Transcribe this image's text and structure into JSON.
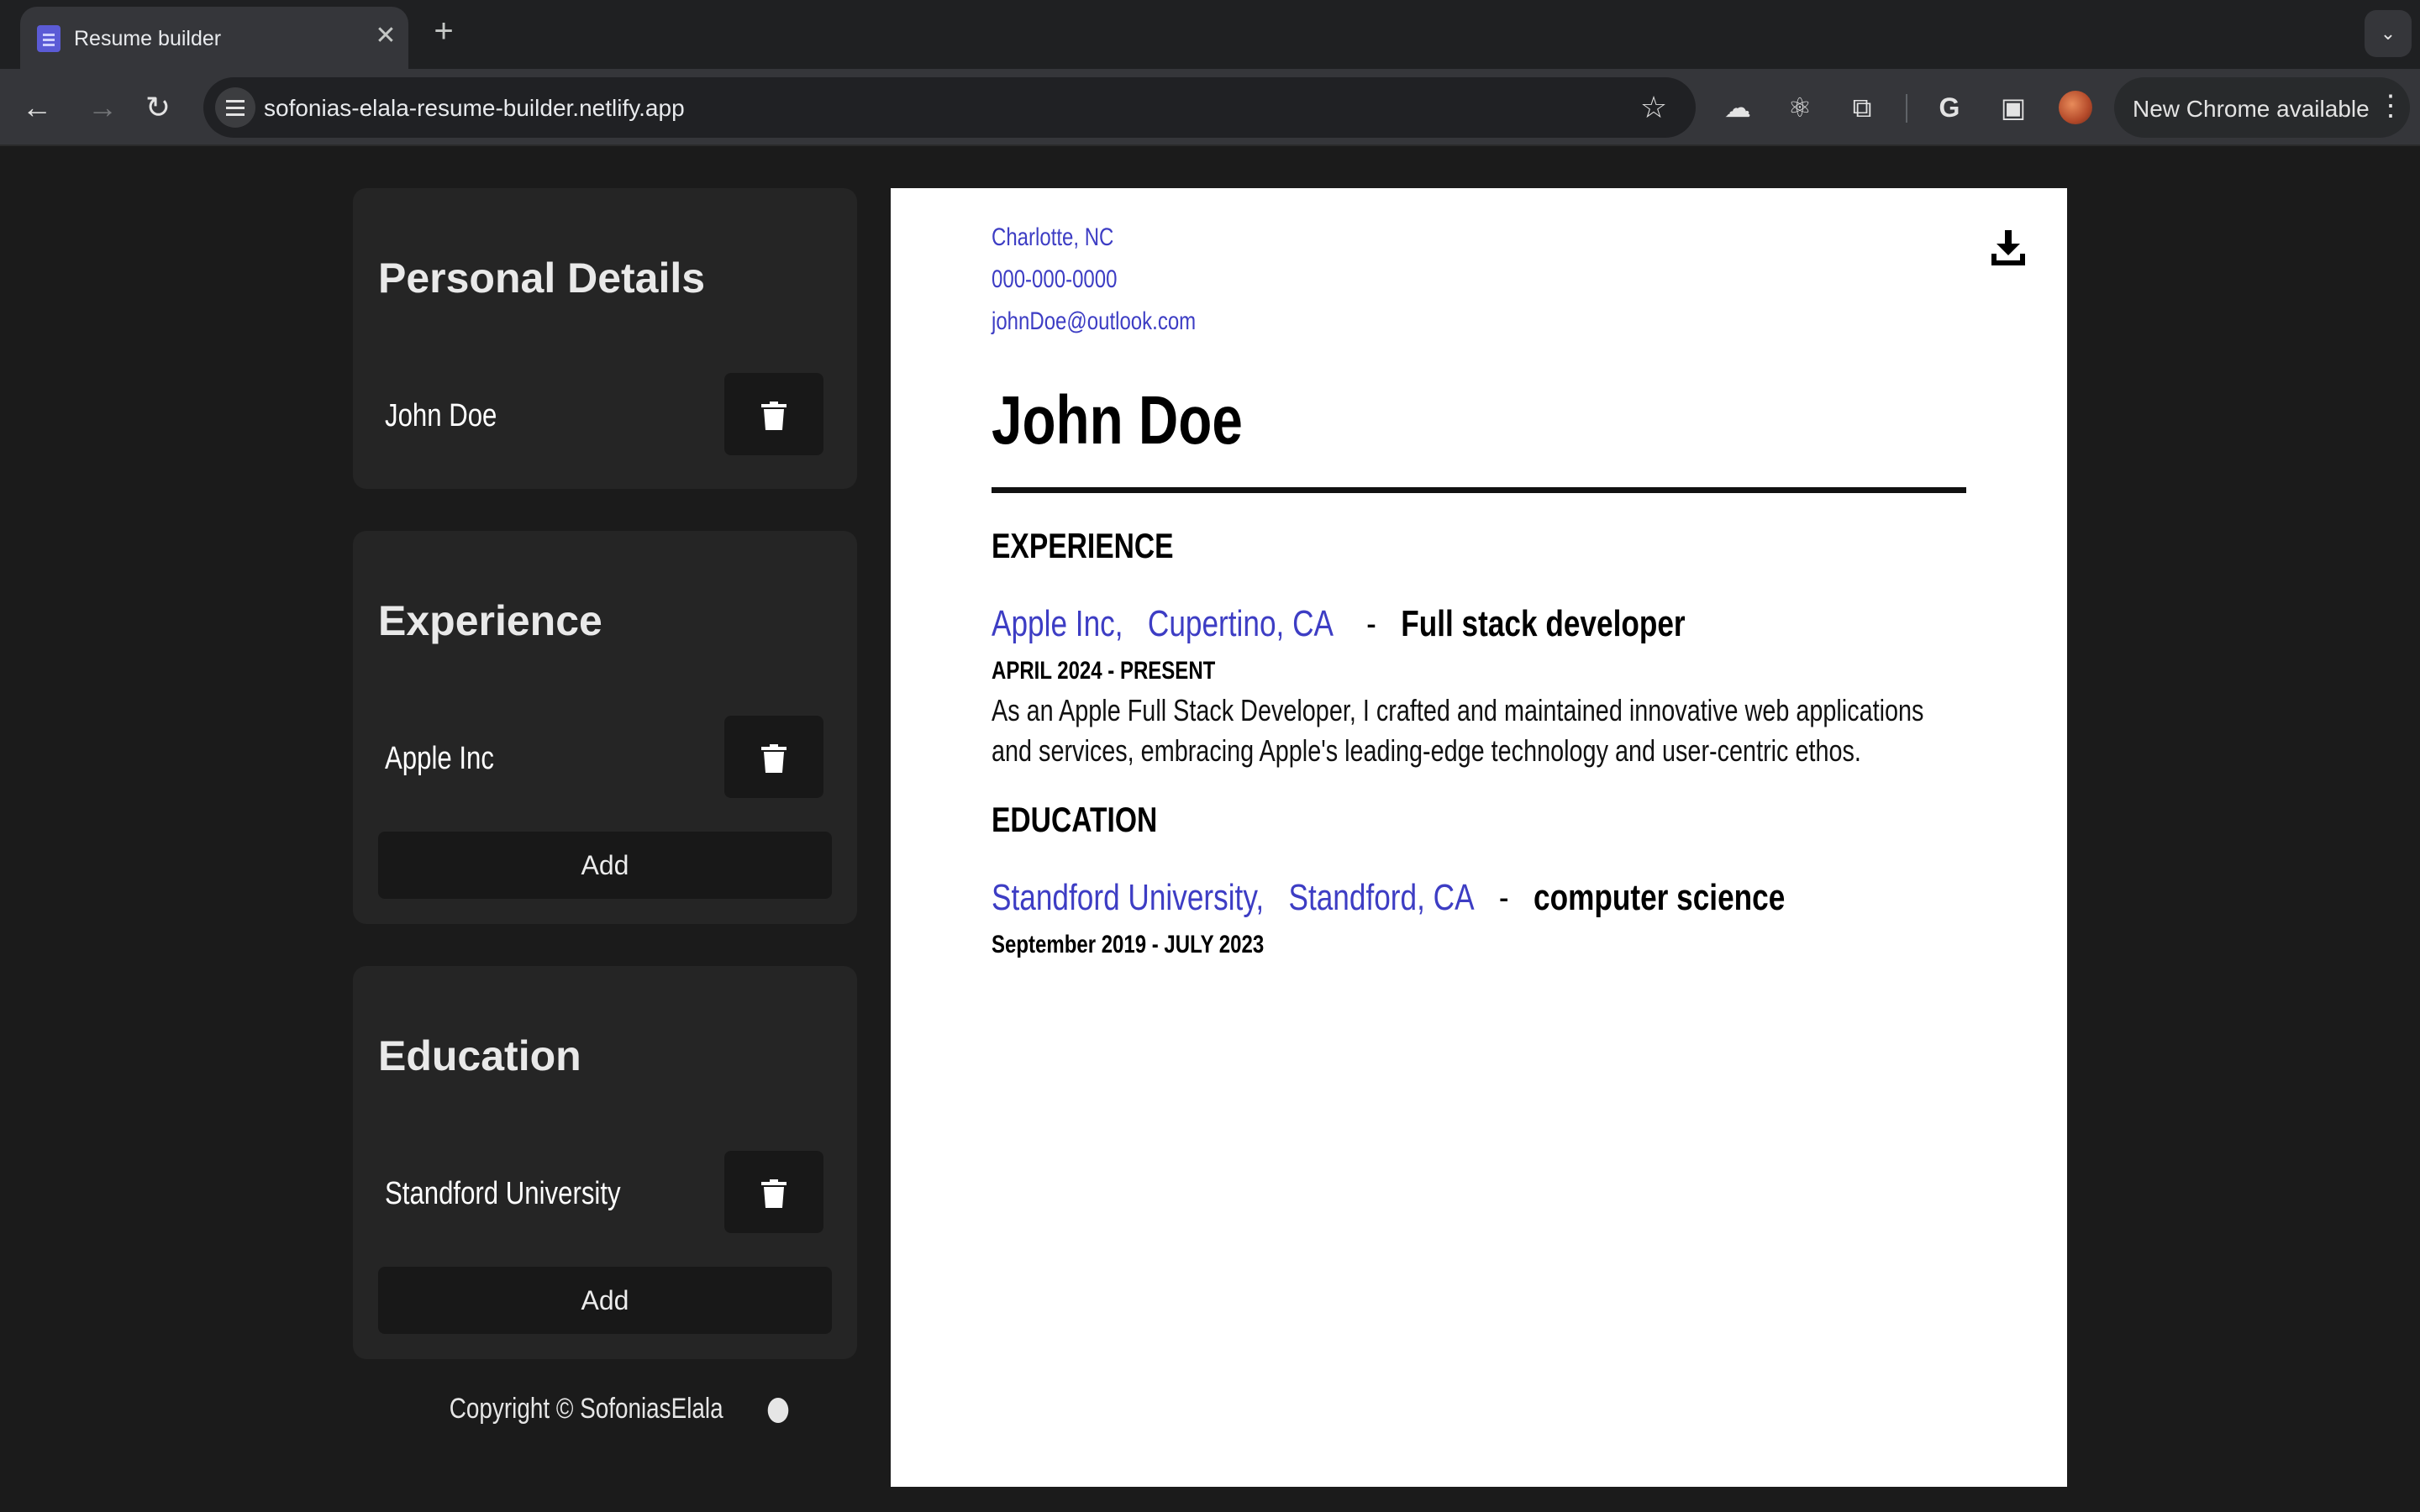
{
  "browser": {
    "tab_title": "Resume builder",
    "url": "sofonias-elala-resume-builder.netlify.app",
    "update_label": "New Chrome available"
  },
  "sidebar": {
    "personal": {
      "title": "Personal Details",
      "item": "John Doe"
    },
    "experience": {
      "title": "Experience",
      "item": "Apple Inc",
      "add_label": "Add"
    },
    "education": {
      "title": "Education",
      "item": "Standford University",
      "add_label": "Add"
    },
    "footer": "Copyright © SofoniasElala"
  },
  "resume": {
    "location": "Charlotte, NC",
    "phone": "000-000-0000",
    "email": "johnDoe@outlook.com",
    "name": "John Doe",
    "experience_heading": "EXPERIENCE",
    "experience": {
      "company": "Apple Inc,",
      "location": "Cupertino, CA",
      "separator": "-",
      "title": "Full stack developer",
      "dates": "APRIL 2024 - PRESENT",
      "description": "As an Apple Full Stack Developer, I crafted and maintained innovative web applications and services, embracing Apple's leading-edge technology and user-centric ethos."
    },
    "education_heading": "EDUCATION",
    "education": {
      "school": "Standford University,",
      "location": "Standford, CA",
      "separator": "-",
      "field": "computer science",
      "dates": "September 2019 - JULY 2023"
    }
  },
  "colors": {
    "accent": "#3d3dc4",
    "page_background": "#1b1b1b",
    "card_background": "#252525"
  }
}
